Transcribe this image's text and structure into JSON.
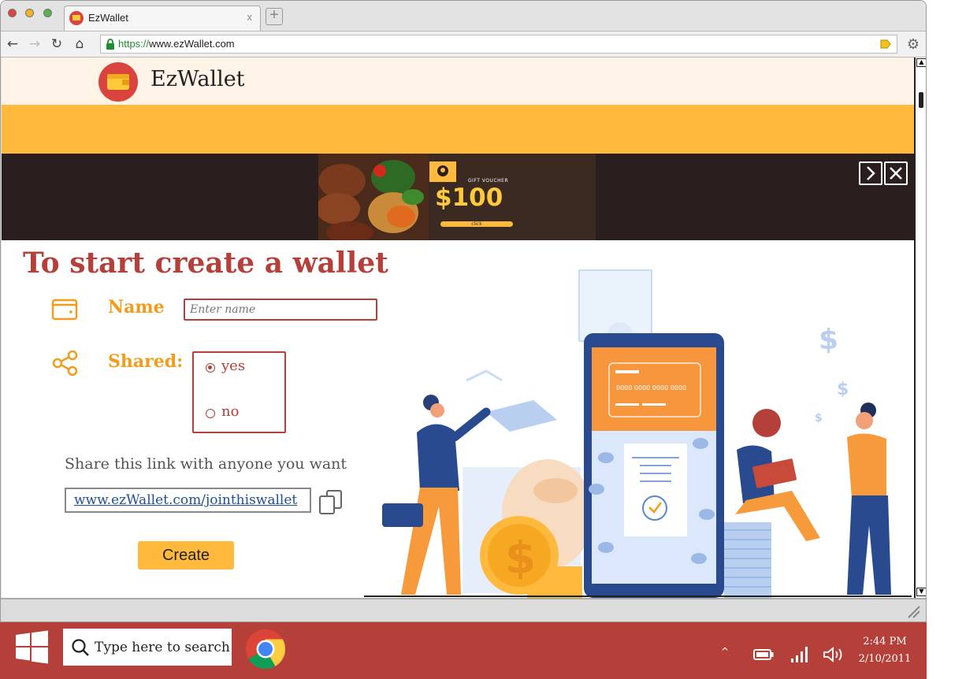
{
  "browser": {
    "tab_title": "EzWallet",
    "tab_close": "x",
    "url_scheme": "https://",
    "url_rest": "www.ezWallet.com"
  },
  "site": {
    "brand": "EzWallet",
    "ad": {
      "label": "GIFT VOUCHER",
      "amount": "$100",
      "cta": "click"
    },
    "page_title": "To start create a wallet",
    "name_label": "Name",
    "name_placeholder": "Enter name",
    "shared_label": "Shared:",
    "shared_options": [
      "yes",
      "no"
    ],
    "shared_selected": "yes",
    "share_text": "Share this link with anyone you want",
    "share_link": "www.ezWallet.com/jointhiswallet",
    "create_label": "Create",
    "card_number": "0000 0000 0000 0000"
  },
  "taskbar": {
    "search_text": "Type here to search",
    "time": "2:44 PM",
    "date": "2/10/2011"
  },
  "colors": {
    "brand_red": "#b5403a",
    "brand_orange": "#ffb93c",
    "label_orange": "#f39c1b",
    "header_bg": "#fff2e6"
  },
  "icons": [
    "wallet-icon",
    "share-icon",
    "copy-icon",
    "lock-icon",
    "bookmark-icon",
    "settings-icon",
    "windows-icon",
    "search-icon",
    "chrome-icon",
    "battery-icon",
    "signal-icon",
    "volume-icon"
  ]
}
